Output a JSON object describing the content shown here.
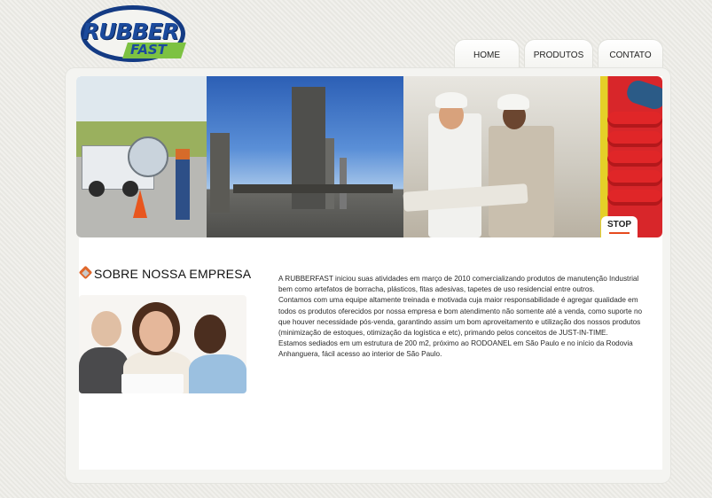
{
  "logo": {
    "line1": "RUBBER",
    "line2": "FAST"
  },
  "nav": {
    "items": [
      "HOME",
      "PRODUTOS",
      "CONTATO"
    ]
  },
  "banner": {
    "stop_label": "STOP"
  },
  "section": {
    "title": "SOBRE NOSSA EMPRESA"
  },
  "about": {
    "paragraphs": [
      "A RUBBERFAST iniciou suas atividades em março de 2010 comercializando produtos de manutenção Industrial bem como artefatos de borracha, plásticos, fitas adesivas, tapetes de uso residencial entre outros.",
      "Contamos com uma equipe altamente treinada e motivada cuja maior responsabilidade é agregar qualidade em todos os produtos oferecidos por nossa empresa e bom atendimento não somente até a venda, como suporte no que houver necessidade pós-venda, garantindo assim um bom aproveitamento e utilização dos nossos produtos (minimização de estoques, otimização da logística e etc), primando pelos conceitos de JUST-IN-TIME.",
      "Estamos sediados em um estrutura de 200 m2, próximo ao RODOANEL em São Paulo e no início da Rodovia Anhanguera, fácil acesso ao interior de São Paulo."
    ]
  },
  "colors": {
    "brand_blue": "#1b4a9c",
    "brand_green": "#7dc242",
    "accent_orange": "#e64a1e"
  }
}
